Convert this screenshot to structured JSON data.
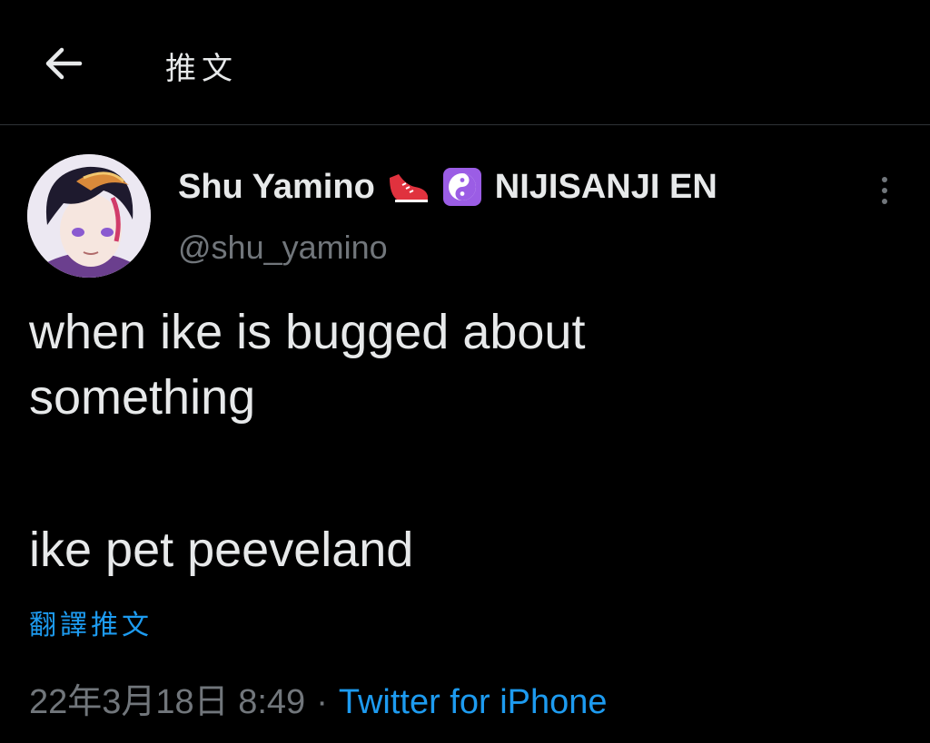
{
  "header": {
    "back_icon": "arrow-left-icon",
    "title": "推文"
  },
  "tweet": {
    "author": {
      "display_name": "Shu Yamino",
      "emoji_1": "sneaker-icon",
      "emoji_2": "yin-yang-icon",
      "org": "NIJISANJI EN",
      "handle": "@shu_yamino"
    },
    "text_lines": [
      "when ike is bugged about",
      "something",
      "ike pet peeveland"
    ],
    "translate_label": "翻譯推文",
    "timestamp": "22年3月18日 8:49",
    "separator": "·",
    "source": "Twitter for iPhone"
  },
  "colors": {
    "background": "#000000",
    "text": "#e7e9ea",
    "muted": "#71767b",
    "accent": "#1d9bf0",
    "divider": "#2f3336"
  }
}
